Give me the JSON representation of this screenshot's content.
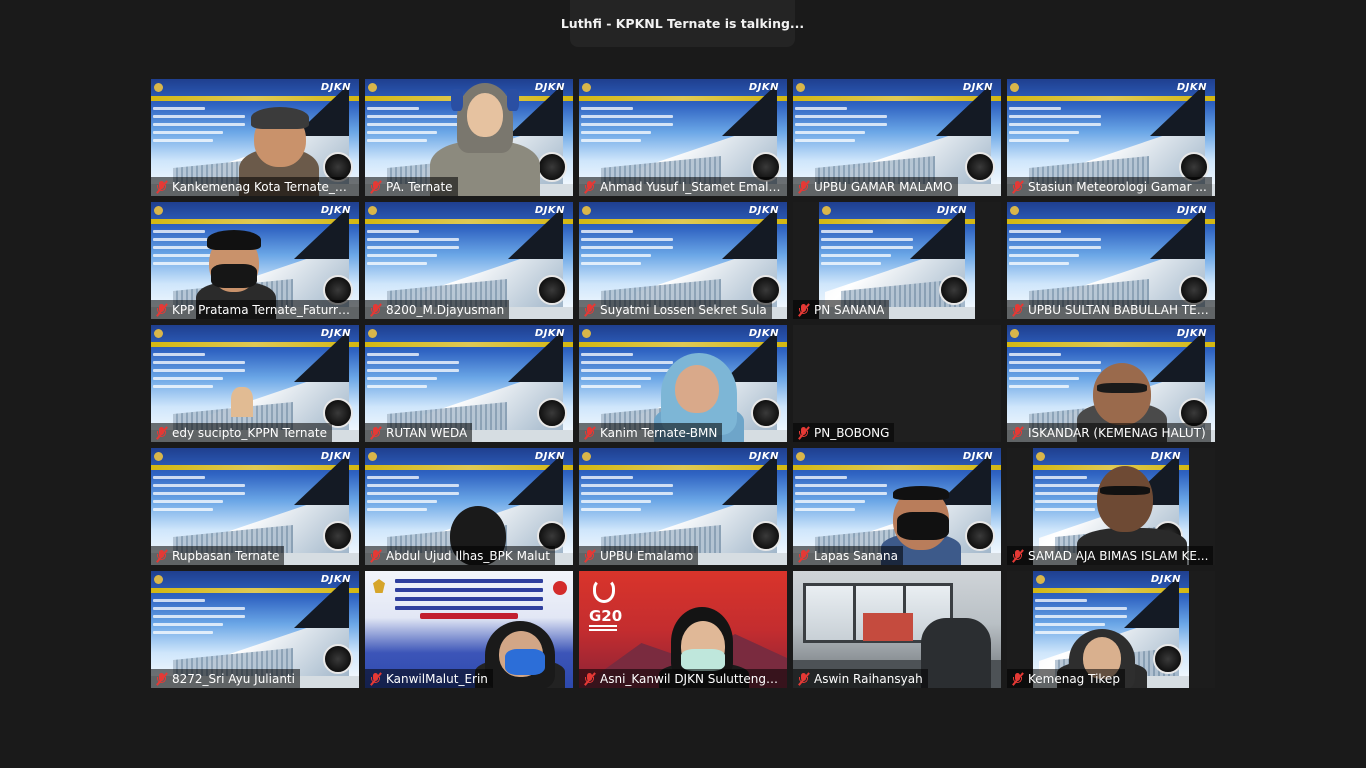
{
  "meeting": {
    "talking_indicator": "Luthfi - KPKNL Ternate is talking..."
  },
  "participants": [
    {
      "name": "Kankemenag Kota Ternate_W...",
      "muted": true,
      "background": "slide",
      "person": "man-cap"
    },
    {
      "name": "PA. Ternate",
      "muted": true,
      "background": "slide",
      "person": "woman-headphones"
    },
    {
      "name": "Ahmad Yusuf I_Stamet Emala...",
      "muted": true,
      "background": "slide",
      "person": "none"
    },
    {
      "name": "UPBU GAMAR MALAMO",
      "muted": true,
      "background": "slide",
      "person": "none"
    },
    {
      "name": "Stasiun Meteorologi Gamar ...",
      "muted": true,
      "background": "slide",
      "person": "none"
    },
    {
      "name": "KPP Pratama Ternate_Faturrac...",
      "muted": true,
      "background": "slide",
      "person": "man-mask"
    },
    {
      "name": "8200_M.Djayusman",
      "muted": true,
      "background": "slide",
      "person": "none"
    },
    {
      "name": "Suyatmi Lossen Sekret Sula",
      "muted": true,
      "background": "slide",
      "person": "none"
    },
    {
      "name": "PN SANANA",
      "muted": true,
      "background": "slide-narrow",
      "person": "none"
    },
    {
      "name": "UPBU SULTAN BABULLAH TER...",
      "muted": true,
      "background": "slide",
      "person": "none"
    },
    {
      "name": "edy sucipto_KPPN Ternate",
      "muted": true,
      "background": "slide",
      "person": "hand"
    },
    {
      "name": "RUTAN WEDA",
      "muted": true,
      "background": "slide",
      "person": "none"
    },
    {
      "name": "Kanim Ternate-BMN",
      "muted": true,
      "background": "slide",
      "person": "woman-hijab"
    },
    {
      "name": "PN_BOBONG",
      "muted": true,
      "background": "empty",
      "person": "none"
    },
    {
      "name": "ISKANDAR (KEMENAG HALUT)",
      "muted": true,
      "background": "slide",
      "person": "man-glasses"
    },
    {
      "name": "Rupbasan Ternate",
      "muted": true,
      "background": "slide",
      "person": "none"
    },
    {
      "name": "Abdul Ujud Ilhas_BPK Malut",
      "muted": true,
      "background": "slide",
      "person": "head-back"
    },
    {
      "name": "UPBU Emalamo",
      "muted": true,
      "background": "slide",
      "person": "none"
    },
    {
      "name": "Lapas Sanana",
      "muted": true,
      "background": "slide",
      "person": "man-mask-2"
    },
    {
      "name": "SAMAD AJA BIMAS ISLAM KE...",
      "muted": true,
      "background": "slide-narrow",
      "person": "man-glasses-2"
    },
    {
      "name": "8272_Sri Ayu Julianti",
      "muted": true,
      "background": "slide",
      "person": "none"
    },
    {
      "name": "KanwilMalut_Erin",
      "muted": true,
      "background": "banner",
      "person": "woman-blue-mask"
    },
    {
      "name": "Asni_Kanwil DJKN Suluttengg...",
      "muted": true,
      "background": "g20",
      "person": "woman-glasses-mask"
    },
    {
      "name": "Aswin Raihansyah",
      "muted": true,
      "background": "room",
      "person": "none"
    },
    {
      "name": "Kemenag Tikep",
      "muted": true,
      "background": "slide-narrow",
      "person": "woman-hijab-2"
    }
  ],
  "slide": {
    "brand": "DJKN"
  },
  "g20": {
    "mark": "G20"
  },
  "colors": {
    "app_background": "#1a1a1a",
    "muted_icon": "#e53935",
    "label_text": "#ffffff"
  }
}
